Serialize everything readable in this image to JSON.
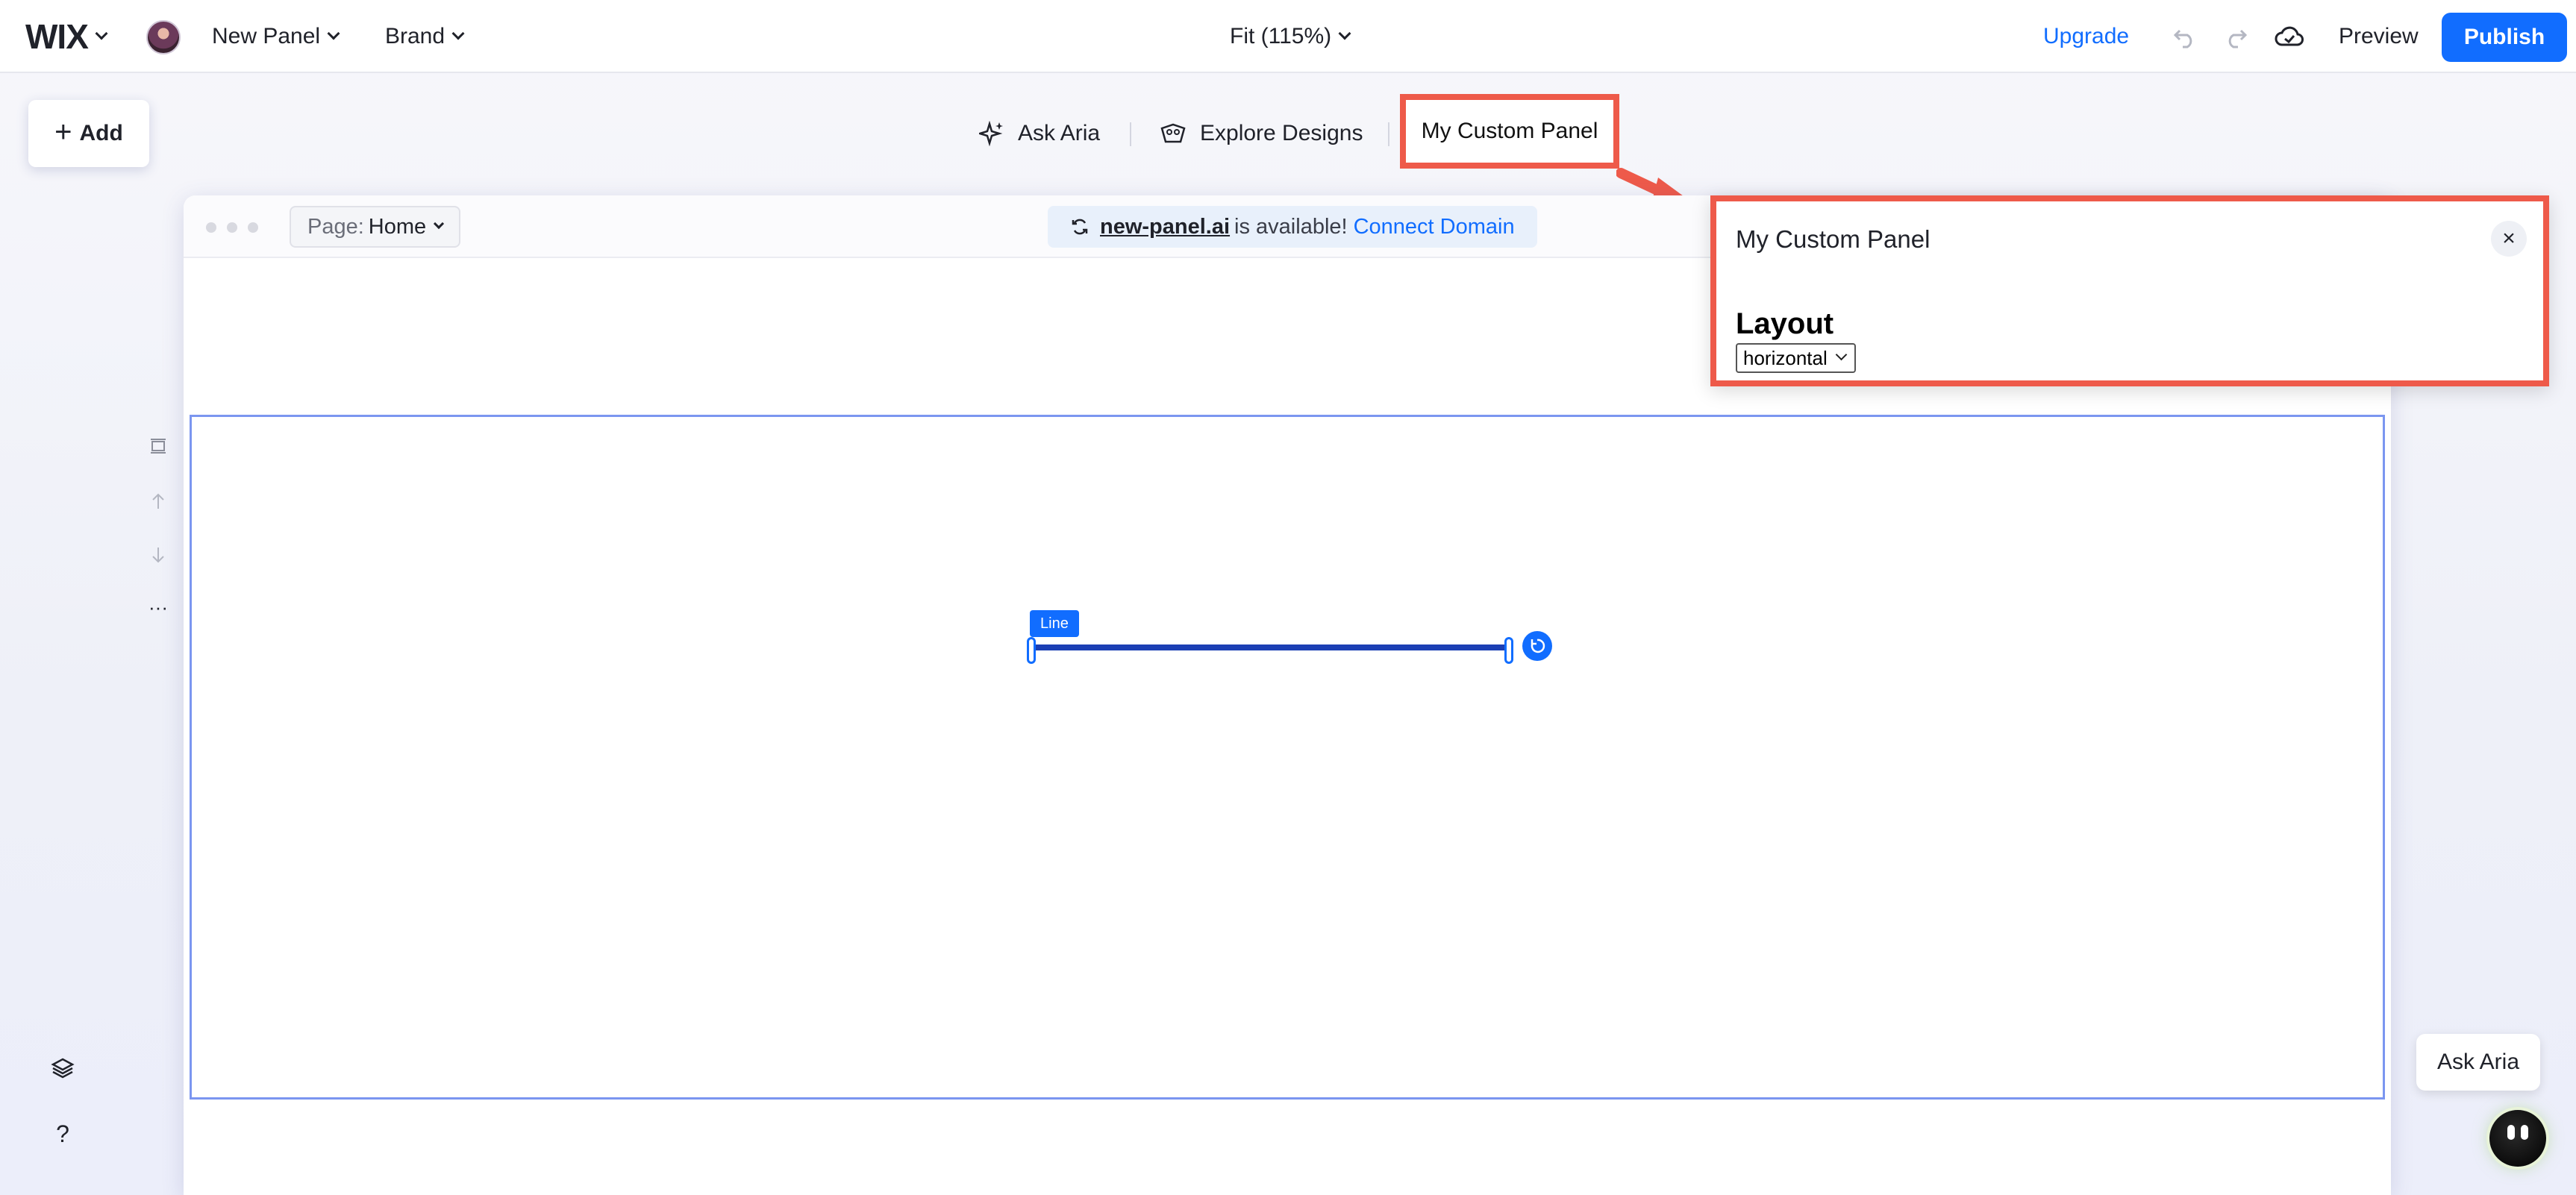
{
  "topbar": {
    "logo": "WIX",
    "site_name": "New Panel",
    "brand": "Brand",
    "zoom": "Fit (115%)",
    "upgrade": "Upgrade",
    "preview": "Preview",
    "publish": "Publish"
  },
  "add_button": {
    "plus": "+",
    "label": "Add"
  },
  "toolbar": {
    "ask_aria": "Ask Aria",
    "explore_designs": "Explore Designs",
    "custom_panel": "My Custom Panel"
  },
  "canvas": {
    "page_label": "Page:",
    "page_value": "Home",
    "domain": "new-panel.ai",
    "domain_text": "is available!",
    "connect_domain": "Connect Domain",
    "line_label": "Line"
  },
  "side_tools": {
    "more": "···"
  },
  "bottom_tools": {
    "help": "?"
  },
  "panel": {
    "title": "My Custom Panel",
    "close": "×",
    "heading": "Layout",
    "select_value": "horizontal"
  },
  "aria_float": {
    "label": "Ask Aria"
  },
  "colors": {
    "accent": "#116dff",
    "highlight": "#ee5a4a",
    "line": "#1b3fb4",
    "selection": "#7b96f0"
  }
}
